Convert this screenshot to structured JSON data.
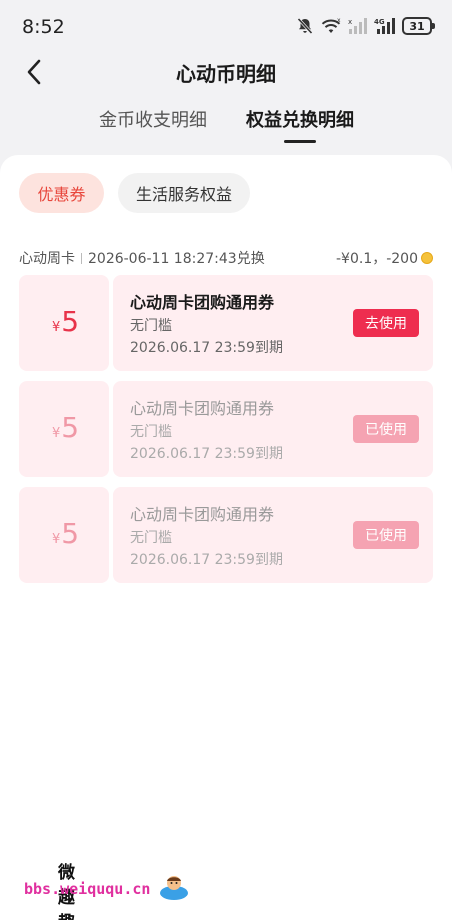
{
  "status_bar": {
    "time": "8:52",
    "network": "4G",
    "battery": "31"
  },
  "header": {
    "title": "心动币明细"
  },
  "tabs": [
    {
      "label": "金币收支明细",
      "active": false
    },
    {
      "label": "权益兑换明细",
      "active": true
    }
  ],
  "filters": [
    {
      "label": "优惠券",
      "active": true
    },
    {
      "label": "生活服务权益",
      "active": false
    }
  ],
  "record": {
    "name": "心动周卡",
    "datetime": "2026-06-11 18:27:43兑换",
    "cost": "-¥0.1，-200"
  },
  "coupons": [
    {
      "currency": "¥",
      "amount": "5",
      "title": "心动周卡团购通用券",
      "condition": "无门槛",
      "expire": "2026.06.17 23:59到期",
      "button": "去使用",
      "state": "available"
    },
    {
      "currency": "¥",
      "amount": "5",
      "title": "心动周卡团购通用券",
      "condition": "无门槛",
      "expire": "2026.06.17 23:59到期",
      "button": "已使用",
      "state": "used"
    },
    {
      "currency": "¥",
      "amount": "5",
      "title": "心动周卡团购通用券",
      "condition": "无门槛",
      "expire": "2026.06.17 23:59到期",
      "button": "已使用",
      "state": "used"
    }
  ],
  "watermark": {
    "title": "微趣趣",
    "url": "bbs.weiququ.cn"
  },
  "colors": {
    "accent": "#ee2d4f",
    "chip_active_bg": "#fde3de",
    "coupon_bg": "#ffeef1",
    "used_button": "#f5a3b2"
  },
  "icons": [
    "mute-bell-icon",
    "wifi-icon",
    "signal-icon",
    "battery-icon",
    "back-arrow-icon",
    "coin-icon"
  ]
}
